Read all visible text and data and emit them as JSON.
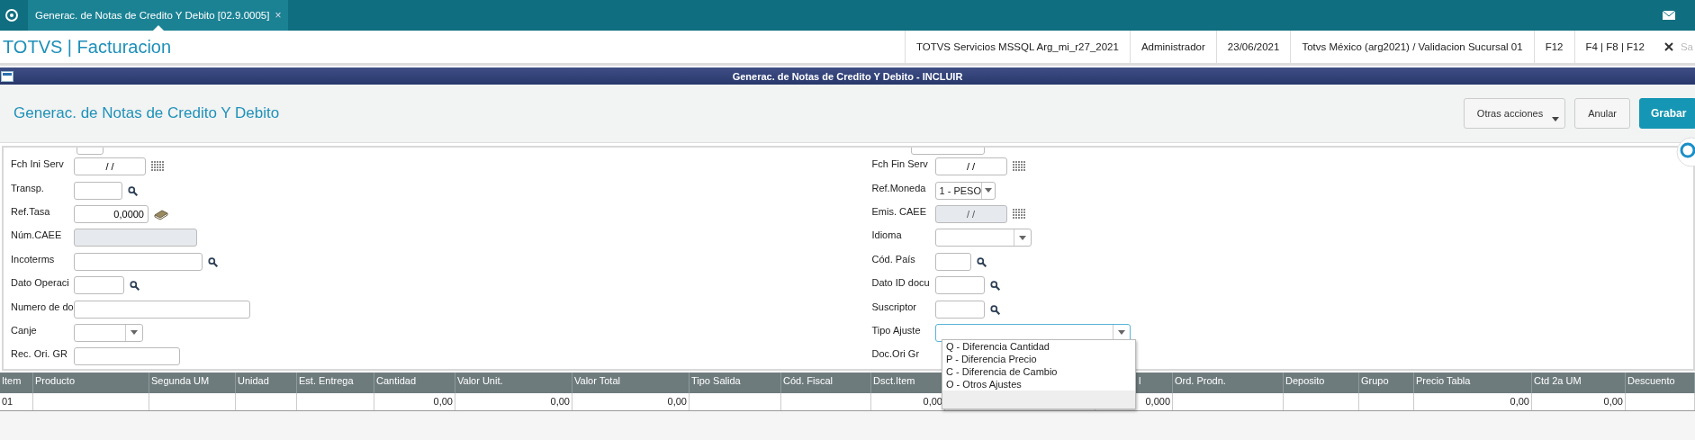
{
  "tabs": [
    {
      "label": "Generac. de Notas de Credito Y Debito [02.9.0005]",
      "close": "×",
      "selected": true
    }
  ],
  "app_bar": {
    "title": "TOTVS | Facturacion",
    "info": [
      "TOTVS Servicios MSSQL Arg_mi_r27_2021",
      "Administrador",
      "23/06/2021",
      "Totvs México (arg2021) / Validacion Sucursal 01",
      "F12",
      "F4 | F8 | F12"
    ],
    "cut_text": "Sa"
  },
  "window": {
    "title": "Generac. de Notas de Credito Y Debito - INCLUIR"
  },
  "header": {
    "title": "Generac. de Notas de Credito Y Debito",
    "buttons": [
      {
        "label": "Otras acciones",
        "kind": "menu"
      },
      {
        "label": "Anular",
        "kind": "plain"
      },
      {
        "label": "Grabar",
        "kind": "primary"
      }
    ]
  },
  "form": {
    "left": [
      {
        "label": "Fch Ini Serv",
        "kind": "date",
        "value": "/ /",
        "disabled": false
      },
      {
        "label": "Transp.",
        "kind": "lookup",
        "disabled": false
      },
      {
        "label": "Ref.Tasa",
        "kind": "currency",
        "value": "0,0000",
        "disabled": false
      },
      {
        "label": "Núm.CAEE",
        "kind": "text",
        "disabled": true
      },
      {
        "label": "Incoterms",
        "kind": "lookup",
        "disabled": false
      },
      {
        "label": "Dato Operaci",
        "kind": "lookup",
        "disabled": false
      },
      {
        "label": "Numero de do",
        "kind": "text",
        "disabled": false
      },
      {
        "label": "Canje",
        "kind": "combo",
        "disabled": false
      },
      {
        "label": "Rec. Ori. GR",
        "kind": "text",
        "disabled": false
      }
    ],
    "right": [
      {
        "label": "Fch Fin Serv",
        "kind": "date",
        "value": "/ /",
        "disabled": false
      },
      {
        "label": "Ref.Moneda",
        "kind": "combo",
        "value": "1 - PESO",
        "disabled": false
      },
      {
        "label": "Emis. CAEE",
        "kind": "date",
        "value": "/ /",
        "disabled": true
      },
      {
        "label": "Idioma",
        "kind": "combo",
        "disabled": false
      },
      {
        "label": "Cód. País",
        "kind": "lookup",
        "disabled": false
      },
      {
        "label": "Dato ID docu",
        "kind": "lookup",
        "disabled": false
      },
      {
        "label": "Suscriptor",
        "kind": "lookup",
        "disabled": false
      },
      {
        "label": "Tipo Ajuste",
        "kind": "combo",
        "disabled": false,
        "expanded": true
      },
      {
        "label": "Doc.Ori Gr",
        "kind": "text"
      }
    ]
  },
  "dropdown": {
    "options": [
      "Q - Diferencia Cantidad",
      "P - Diferencia Precio",
      "C - Diferencia de Cambio",
      "O - Otros Ajustes"
    ]
  },
  "table": {
    "columns": [
      {
        "label": "Item"
      },
      {
        "label": "Producto"
      },
      {
        "label": "Segunda UM"
      },
      {
        "label": "Unidad"
      },
      {
        "label": "Est. Entrega"
      },
      {
        "label": "Cantidad"
      },
      {
        "label": "Valor Unit."
      },
      {
        "label": "Valor Total"
      },
      {
        "label": "Tipo Salida"
      },
      {
        "label": "Cód. Fiscal"
      },
      {
        "label": "Dsct.Item"
      },
      {},
      {
        "label": "l"
      },
      {
        "label": "Ord. Prodn."
      },
      {
        "label": "Deposito"
      },
      {
        "label": "Grupo"
      },
      {
        "label": "Precio Tabla"
      },
      {
        "label": "Ctd 2a UM"
      },
      {
        "label": "Descuento"
      }
    ],
    "rows": [
      {
        "cells": [
          "01",
          "",
          "",
          "",
          "",
          "0,00",
          "0,00",
          "0,00",
          "",
          "",
          "0,00",
          "",
          "0,000",
          "",
          "",
          "",
          "0,00",
          "0,00",
          ""
        ]
      }
    ]
  }
}
